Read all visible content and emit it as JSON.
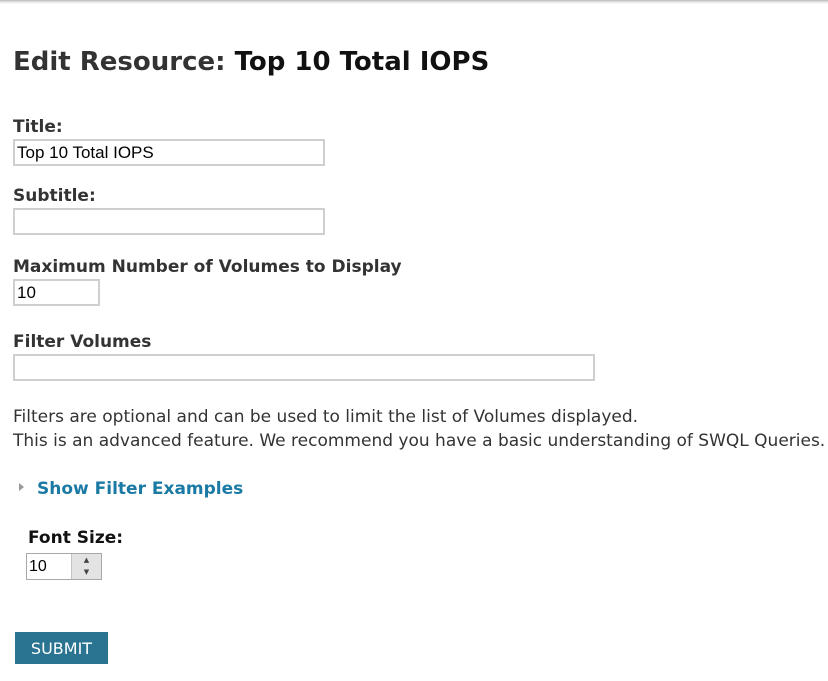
{
  "header": {
    "prefix": "Edit Resource:",
    "resource_name": "Top 10 Total IOPS"
  },
  "form": {
    "title": {
      "label": "Title:",
      "value": "Top 10 Total IOPS"
    },
    "subtitle": {
      "label": "Subtitle:",
      "value": ""
    },
    "max_volumes": {
      "label": "Maximum Number of Volumes to Display",
      "value": "10"
    },
    "filter": {
      "label": "Filter Volumes",
      "value": ""
    },
    "help_lines": [
      "Filters are optional and can be used to limit the list of Volumes displayed.",
      "This is an advanced feature. We recommend you have a basic understanding of SWQL Queries."
    ],
    "show_examples_label": "Show Filter Examples",
    "font_size": {
      "label": "Font Size:",
      "value": "10"
    },
    "submit_label": "SUBMIT"
  },
  "colors": {
    "link": "#1b7aa4",
    "submit_bg": "#2a7391",
    "text": "#333333",
    "input_border": "#cfcfcf"
  },
  "icons": {
    "expand": "triangle-right-icon",
    "spin_up": "caret-up-icon",
    "spin_down": "caret-down-icon"
  }
}
